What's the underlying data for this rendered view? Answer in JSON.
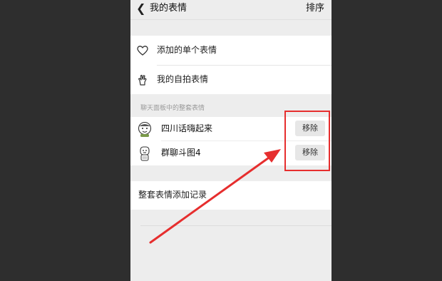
{
  "header": {
    "back_icon": "chevron-left-icon",
    "title": "我的表情",
    "sort_label": "排序"
  },
  "menu": {
    "items": [
      {
        "icon": "heart-icon",
        "label": "添加的单个表情"
      },
      {
        "icon": "hand-gesture-icon",
        "label": "我的自拍表情"
      }
    ]
  },
  "packs": {
    "section_label": "聊天面板中的整套表情",
    "items": [
      {
        "name": "四川话嗨起来",
        "remove_label": "移除"
      },
      {
        "name": "群聊斗图4",
        "remove_label": "移除"
      }
    ]
  },
  "record": {
    "label": "整套表情添加记录"
  },
  "annotation": {
    "highlight_color": "#e62e2e",
    "arrow_color": "#e62e2e"
  }
}
